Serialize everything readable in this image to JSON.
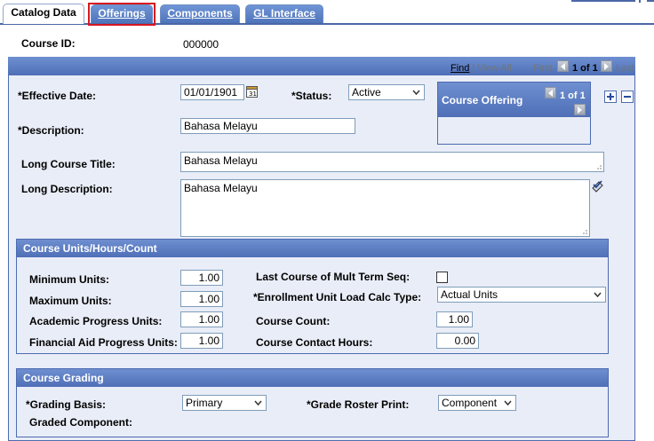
{
  "tabs": [
    {
      "label": "Catalog Data",
      "active": true
    },
    {
      "label": "Offerings",
      "active": false,
      "highlighted": true
    },
    {
      "label": "Components",
      "active": false
    },
    {
      "label": "GL Interface",
      "active": false
    }
  ],
  "header": {
    "course_id_label": "Course ID:",
    "course_id_value": "000000"
  },
  "navbar": {
    "find": "Find",
    "separator": "|",
    "view_all": "View All",
    "first": "First",
    "count": "1 of 1",
    "last": "Last"
  },
  "main": {
    "effective_date_label": "*Effective Date:",
    "effective_date_value": "01/01/1901",
    "status_label": "*Status:",
    "status_value": "Active",
    "description_label": "*Description:",
    "description_value": "Bahasa Melayu",
    "long_title_label": "Long Course Title:",
    "long_title_value": "Bahasa Melayu",
    "long_desc_label": "Long Description:",
    "long_desc_value": "Bahasa Melayu"
  },
  "offering": {
    "title": "Course Offering",
    "count": "1 of 1"
  },
  "units": {
    "title": "Course Units/Hours/Count",
    "min_label": "Minimum Units:",
    "min_value": "1.00",
    "max_label": "Maximum Units:",
    "max_value": "1.00",
    "academic_label": "Academic Progress Units:",
    "academic_value": "1.00",
    "finaid_label": "Financial Aid Progress Units:",
    "finaid_value": "1.00",
    "last_course_label": "Last Course of Mult Term Seq:",
    "enroll_label": "*Enrollment Unit Load Calc Type:",
    "enroll_value": "Actual Units",
    "count_label": "Course Count:",
    "count_value": "1.00",
    "contact_label": "Course Contact Hours:",
    "contact_value": "0.00"
  },
  "grading": {
    "title": "Course Grading",
    "basis_label": "*Grading Basis:",
    "basis_value": "Primary",
    "roster_label": "*Grade Roster Print:",
    "roster_value": "Component",
    "graded_component_label": "Graded Component:"
  },
  "colors": {
    "accent": "#4f6fb7",
    "panel_bg": "#e9edf7",
    "highlight": "#d71920"
  }
}
